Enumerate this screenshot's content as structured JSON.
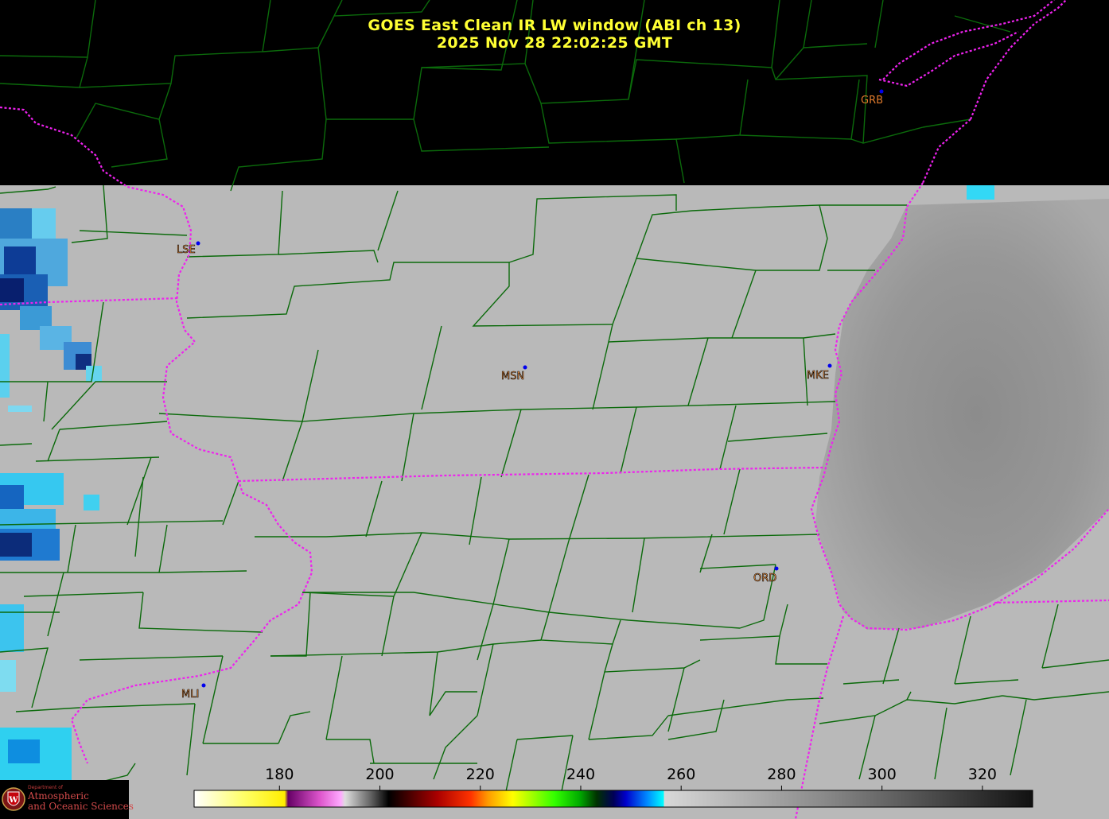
{
  "title": {
    "line1": "GOES East Clean IR LW window (ABI ch 13)",
    "line2": "2025 Nov 28  22:02:25 GMT"
  },
  "stations": [
    {
      "code": "LSE"
    },
    {
      "code": "MSN"
    },
    {
      "code": "MKE"
    },
    {
      "code": "ORD"
    },
    {
      "code": "MLI"
    },
    {
      "code": "GRB"
    }
  ],
  "colorbar": {
    "ticks": [
      180,
      200,
      220,
      240,
      260,
      280,
      300,
      320
    ],
    "range": [
      163,
      330
    ],
    "colors": {
      "very_cold": "#ffffff",
      "cold_cloud": "#00ffff",
      "warm_surface": "#111111"
    }
  },
  "logo": {
    "line1": "Department of",
    "line2": "Atmospheric",
    "line3": "and Oceanic Sciences"
  }
}
